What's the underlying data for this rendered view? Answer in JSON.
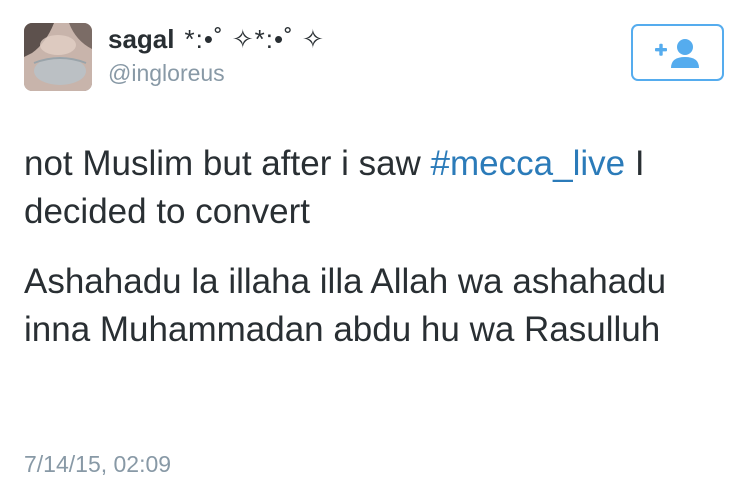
{
  "user": {
    "display_name": "sagal",
    "display_name_decoration": "*:•˚ ✧*:•˚ ✧",
    "handle": "@ingloreus"
  },
  "follow_button": {
    "icon": "add-user-icon",
    "color": "#55acee"
  },
  "tweet": {
    "line1_before": "not Muslim but after i saw ",
    "hashtag": "#mecca_live",
    "line1_after": " I decided to convert",
    "paragraph2": "Ashahadu la illaha illa Allah wa ashahadu inna Muhammadan abdu hu wa Rasulluh",
    "timestamp": "7/14/15, 02:09"
  },
  "colors": {
    "text": "#292f33",
    "muted": "#8899a6",
    "link": "#2b7bb9",
    "accent": "#55acee"
  }
}
